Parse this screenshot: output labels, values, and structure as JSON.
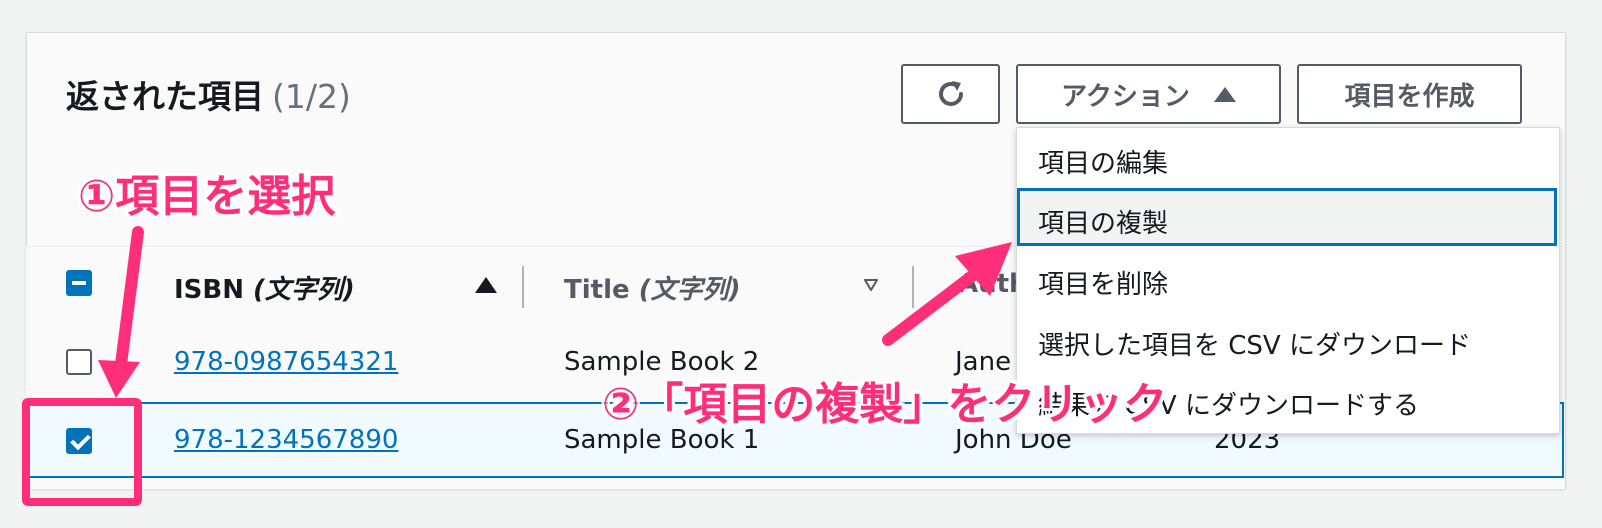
{
  "header": {
    "title": "返された項目",
    "count": "(1/2)"
  },
  "toolbar": {
    "refresh_icon": "refresh-icon",
    "actions_label": "アクション",
    "create_label": "項目を作成"
  },
  "actions_menu": {
    "items": [
      "項目の編集",
      "項目の複製",
      "項目を削除",
      "選択した項目を CSV にダウンロード",
      "結果を CSV にダウンロードする"
    ],
    "focused_index": 1
  },
  "table": {
    "columns": [
      {
        "name": "ISBN",
        "type": "(文字列)",
        "sort": "ascending"
      },
      {
        "name": "Title",
        "type": "(文字列)",
        "sort": "descending-inactive"
      },
      {
        "name": "Auth"
      }
    ],
    "rows": [
      {
        "isbn": "978-0987654321",
        "title": "Sample Book 2",
        "author": "Jane",
        "selected": false
      },
      {
        "isbn": "978-1234567890",
        "title": "Sample Book 1",
        "author": "John Doe",
        "year": "2023",
        "selected": true
      }
    ]
  },
  "annotations": {
    "step1": "①項目を選択",
    "step2": "②「項目の複製」をクリック"
  },
  "colors": {
    "accent": "#0073bb",
    "annotation": "#ff2e78"
  }
}
